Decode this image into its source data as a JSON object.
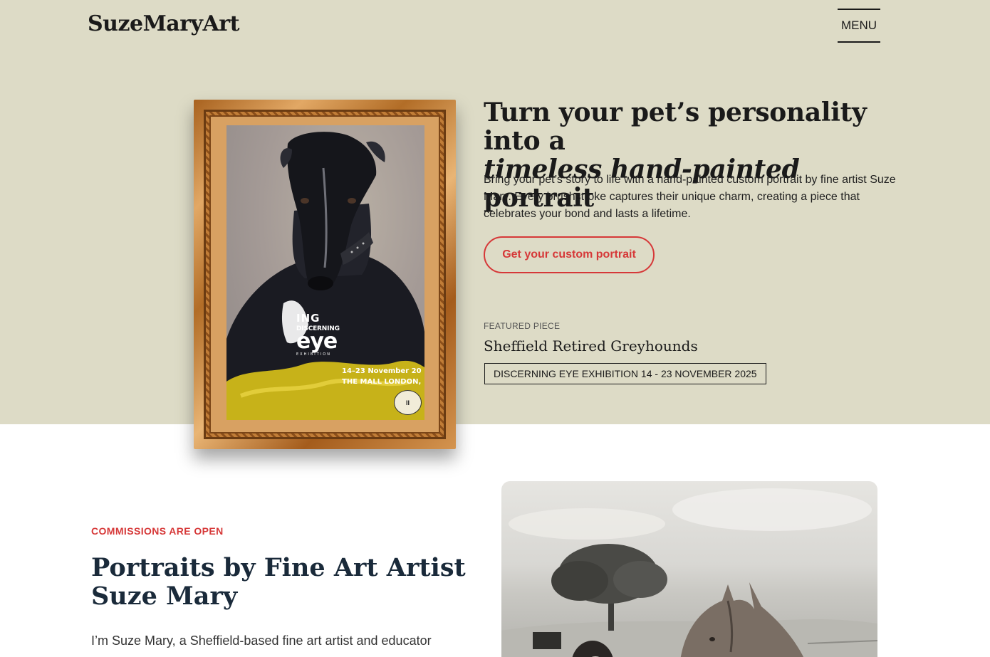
{
  "header": {
    "logo": "SuzeMaryArt",
    "menu_label": "MENU"
  },
  "hero": {
    "title_line1": "Turn your pet’s personality into a",
    "title_emphasis": "timeless hand-painted",
    "title_end": " portrait",
    "description": "Bring your pet’s story to life with a hand-painted custom portrait by fine artist Suze Mary. Every brushstroke captures their unique charm, creating a piece that celebrates your bond and lasts a lifetime.",
    "cta_label": "Get your custom portrait",
    "pause_label": "II"
  },
  "artwork_overlay": {
    "brand_top": "ING",
    "brand_mid": "DISCERNING",
    "brand_main": "eye",
    "brand_sub": "EXHIBITION",
    "date_line1": "14–23 November 20",
    "date_line2": "THE MALL LONDON,"
  },
  "featured": {
    "label": "FEATURED PIECE",
    "title": "Sheffield Retired Greyhounds",
    "badge": "DISCERNING EYE EXHIBITION 14 - 23 NOVEMBER 2025"
  },
  "about": {
    "eyebrow": "COMMISSIONS ARE OPEN",
    "title": "Portraits by Fine Art Artist Suze Mary",
    "intro": "I’m Suze Mary, a Sheffield-based fine art artist and educator"
  },
  "colors": {
    "hero_bg": "#dddbc6",
    "accent": "#d63838",
    "text_dark": "#1a1a1a"
  }
}
